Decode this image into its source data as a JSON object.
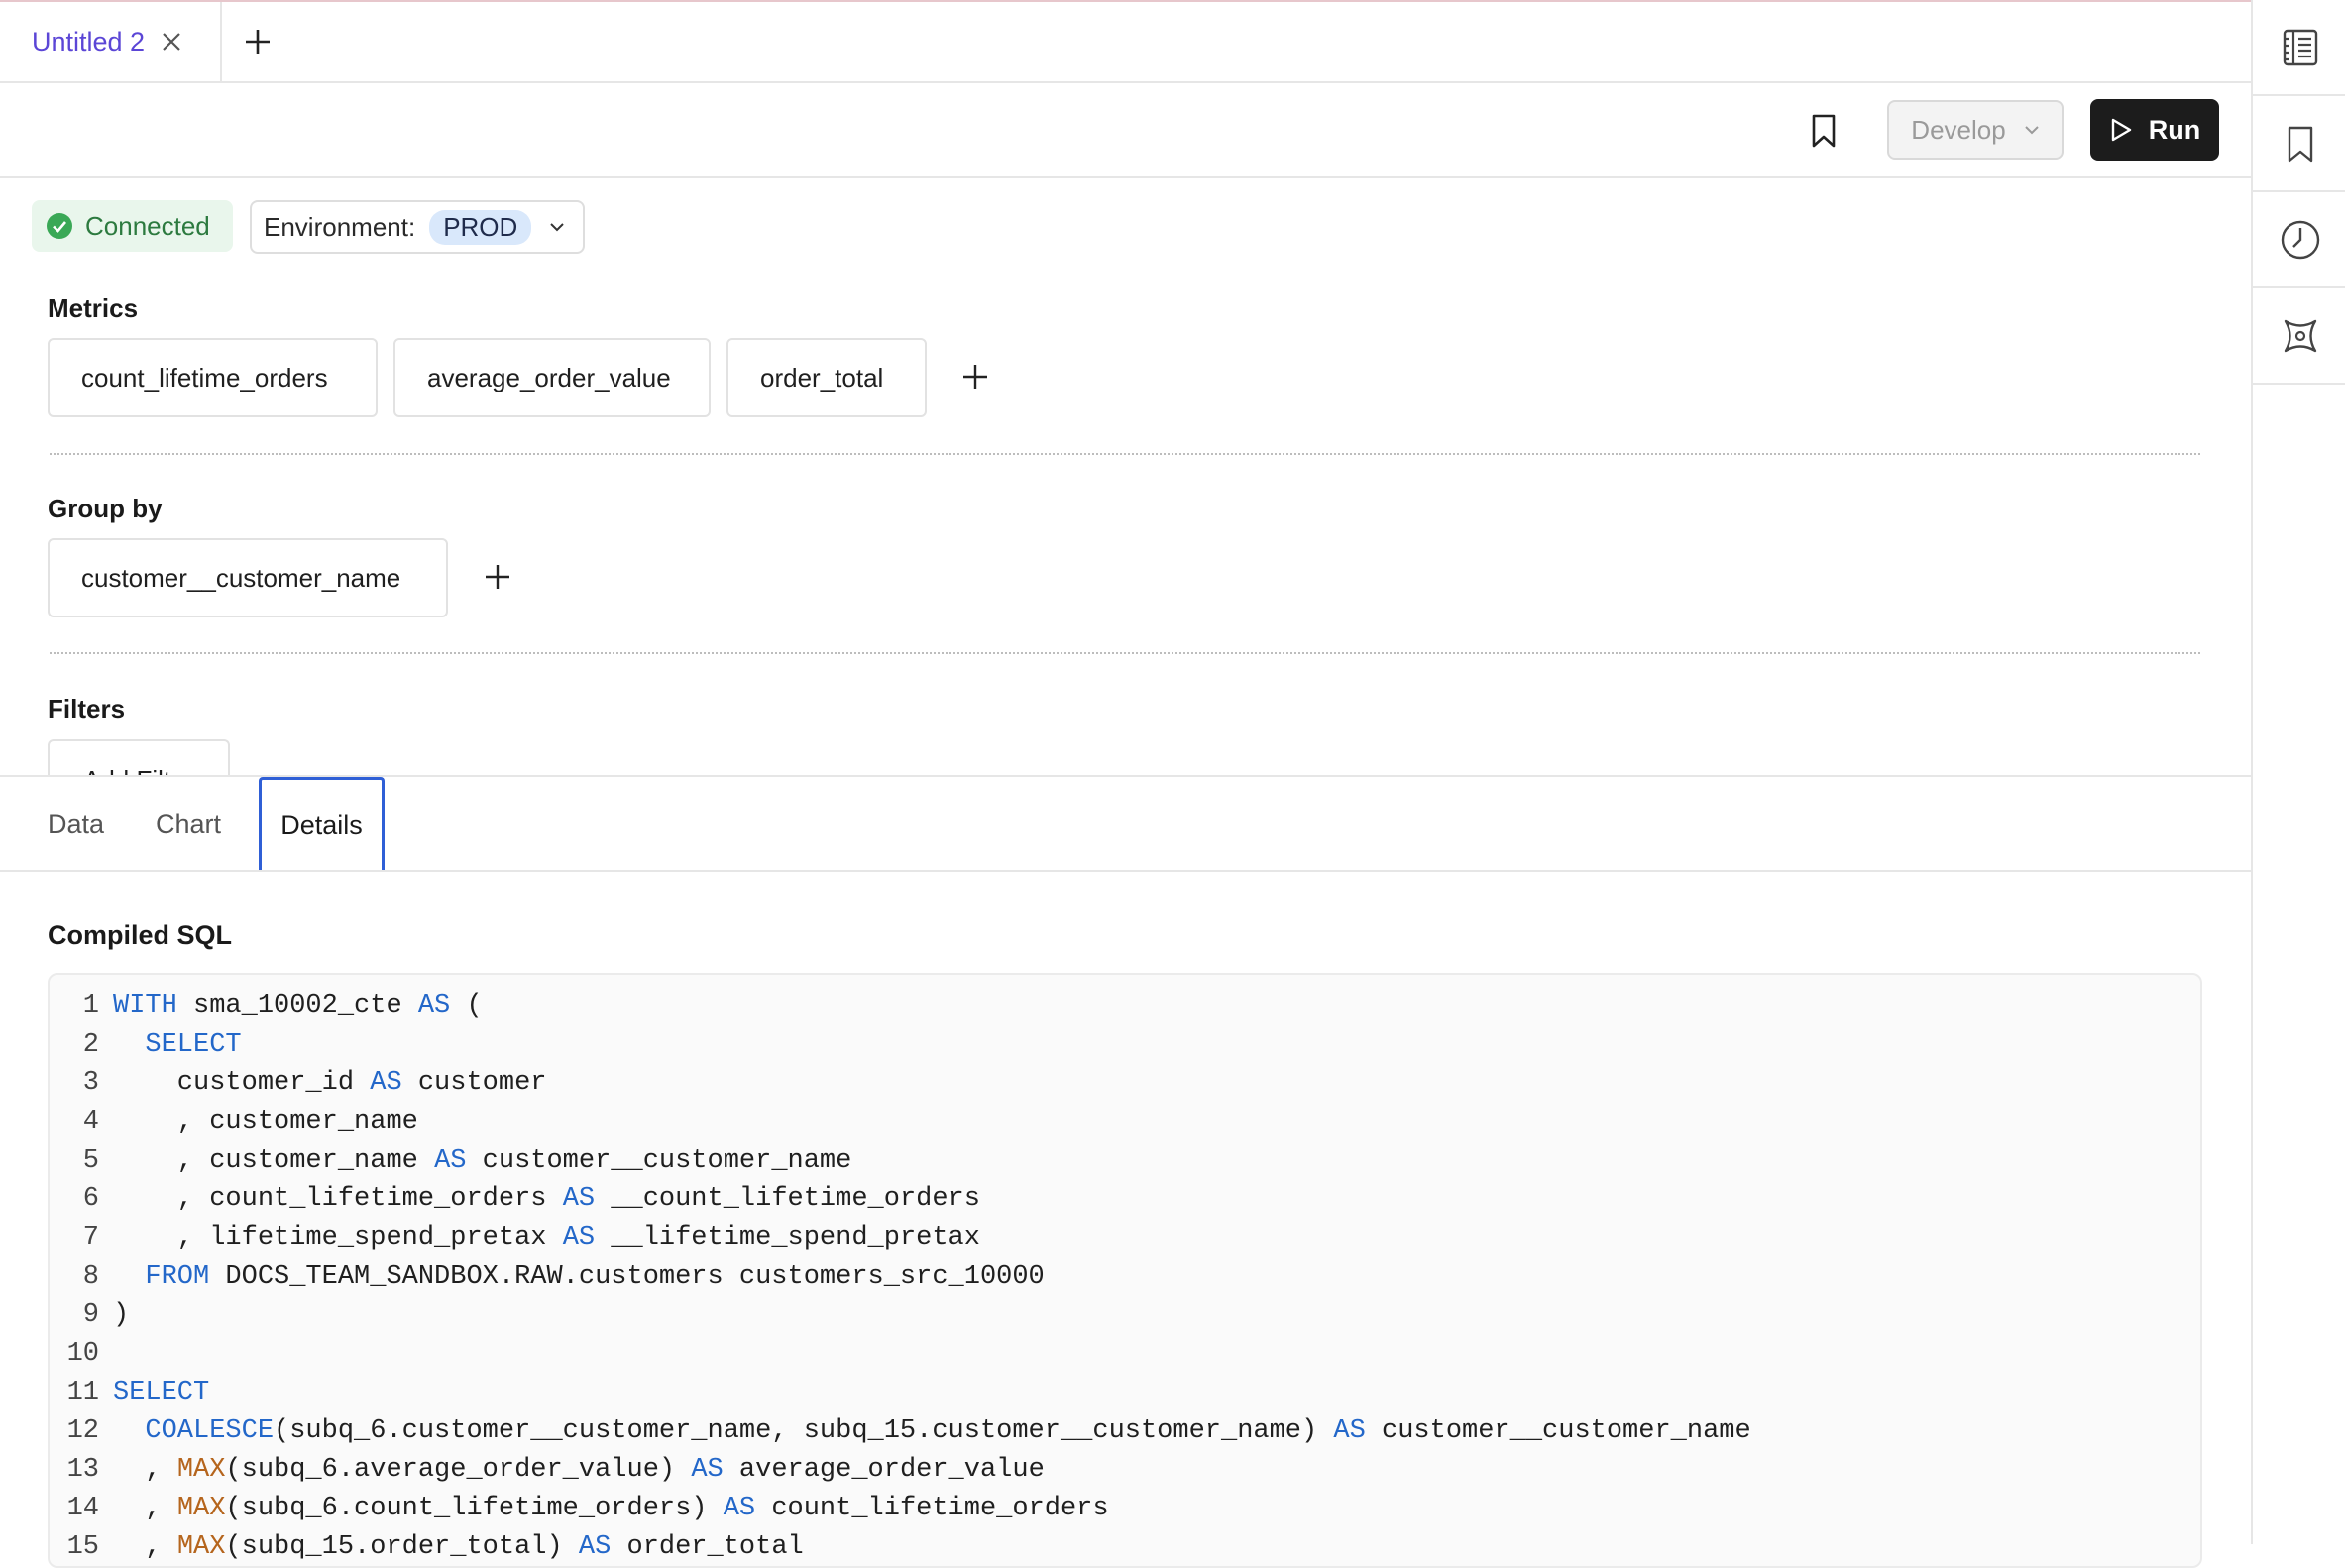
{
  "tabs": {
    "active_tab_title": "Untitled 2"
  },
  "toolbar": {
    "develop_label": "Develop",
    "run_label": "Run"
  },
  "connection": {
    "status": "Connected",
    "environment_label": "Environment:",
    "environment_value": "PROD"
  },
  "metrics": {
    "title": "Metrics",
    "items": [
      "count_lifetime_orders",
      "average_order_value",
      "order_total"
    ]
  },
  "group_by": {
    "title": "Group by",
    "items": [
      "customer__customer_name"
    ]
  },
  "filters": {
    "title": "Filters",
    "add_label": "Add Filter"
  },
  "lower_tabs": [
    "Data",
    "Chart",
    "Details"
  ],
  "active_lower_tab": "Details",
  "details": {
    "title": "Compiled SQL",
    "lines": [
      [
        {
          "t": "WITH",
          "c": "kw"
        },
        {
          "t": " sma_10002_cte "
        },
        {
          "t": "AS",
          "c": "kw"
        },
        {
          "t": " ("
        }
      ],
      [
        {
          "t": "  "
        },
        {
          "t": "SELECT",
          "c": "kw"
        }
      ],
      [
        {
          "t": "    customer_id "
        },
        {
          "t": "AS",
          "c": "kw"
        },
        {
          "t": " customer"
        }
      ],
      [
        {
          "t": "    , customer_name"
        }
      ],
      [
        {
          "t": "    , customer_name "
        },
        {
          "t": "AS",
          "c": "kw"
        },
        {
          "t": " customer__customer_name"
        }
      ],
      [
        {
          "t": "    , count_lifetime_orders "
        },
        {
          "t": "AS",
          "c": "kw"
        },
        {
          "t": " __count_lifetime_orders"
        }
      ],
      [
        {
          "t": "    , lifetime_spend_pretax "
        },
        {
          "t": "AS",
          "c": "kw"
        },
        {
          "t": " __lifetime_spend_pretax"
        }
      ],
      [
        {
          "t": "  "
        },
        {
          "t": "FROM",
          "c": "kw"
        },
        {
          "t": " DOCS_TEAM_SANDBOX.RAW.customers customers_src_10000"
        }
      ],
      [
        {
          "t": ")"
        }
      ],
      [
        {
          "t": ""
        }
      ],
      [
        {
          "t": "SELECT",
          "c": "kw"
        }
      ],
      [
        {
          "t": "  "
        },
        {
          "t": "COALESCE",
          "c": "kw"
        },
        {
          "t": "(subq_6.customer__customer_name, subq_15.customer__customer_name) "
        },
        {
          "t": "AS",
          "c": "kw"
        },
        {
          "t": " customer__customer_name"
        }
      ],
      [
        {
          "t": "  , "
        },
        {
          "t": "MAX",
          "c": "fn"
        },
        {
          "t": "(subq_6.average_order_value) "
        },
        {
          "t": "AS",
          "c": "kw"
        },
        {
          "t": " average_order_value"
        }
      ],
      [
        {
          "t": "  , "
        },
        {
          "t": "MAX",
          "c": "fn"
        },
        {
          "t": "(subq_6.count_lifetime_orders) "
        },
        {
          "t": "AS",
          "c": "kw"
        },
        {
          "t": " count_lifetime_orders"
        }
      ],
      [
        {
          "t": "  , "
        },
        {
          "t": "MAX",
          "c": "fn"
        },
        {
          "t": "(subq_15.order_total) "
        },
        {
          "t": "AS",
          "c": "kw"
        },
        {
          "t": " order_total"
        }
      ]
    ]
  },
  "icons": {
    "rail": [
      "notebook-icon",
      "bookmark-icon",
      "history-icon",
      "integration-icon"
    ]
  }
}
